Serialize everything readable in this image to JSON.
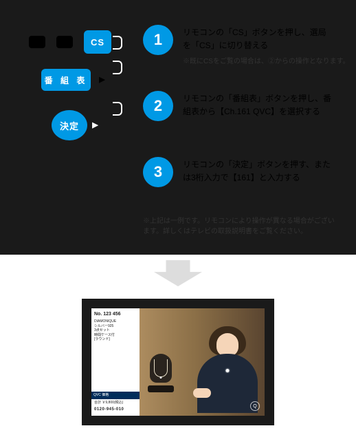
{
  "remote": {
    "cs_label": "CS",
    "guide_label": "番 組 表",
    "enter_label": "決定"
  },
  "steps": [
    {
      "num": "1",
      "text": "リモコンの「CS」ボタンを押し、選局を「CS」に切り替える",
      "note": "※既にCSをご覧の場合は、②からの操作となります。"
    },
    {
      "num": "2",
      "text": "リモコンの「番組表」ボタンを押し、番組表から【Ch.161 QVC】を選択する"
    },
    {
      "num": "3",
      "text": "リモコンの「決定」ボタンを押す、または3桁入力で【161】と入力する"
    }
  ],
  "footnote": "※上記は一例です。リモコンにより操作が異なる場合がございます。詳しくはテレビの取扱説明書をご覧ください。",
  "tv": {
    "product_no": "No. 123 456",
    "product_lines": "DIAMONIQUE\nシルバー925\n3点セット\n時間ケース付\n[ラウンド]",
    "price_label": "QVC 価格",
    "price": "合計 ￥9,800(税込)",
    "phone": "0120-945-010",
    "logo": "Q"
  }
}
